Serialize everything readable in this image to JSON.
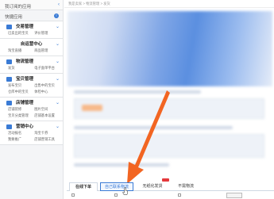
{
  "sidebar": {
    "top": "我订阅的应用",
    "quick": "快捷应用",
    "sections": [
      {
        "title": "交易管理",
        "rows": [
          [
            "已卖出的宝贝",
            "评价管理"
          ]
        ]
      },
      {
        "title": "自运营中心",
        "centered": true,
        "rows": [
          [
            "淘宝直播",
            "商品管理"
          ]
        ]
      },
      {
        "title": "物流管理",
        "rows": [
          [
            "发货",
            "电子面单平台"
          ]
        ]
      },
      {
        "title": "宝贝管理",
        "rows": [
          [
            "发布宝贝",
            "出售中的宝贝"
          ],
          [
            "仓库中的宝贝",
            "体检中心"
          ]
        ]
      },
      {
        "title": "店铺管理",
        "rows": [
          [
            "店铺装修",
            "图片空间"
          ],
          [
            "宝贝分类管理",
            "店铺基本设置"
          ]
        ]
      },
      {
        "title": "营销中心",
        "rows": [
          [
            "活动报名",
            "淘宝卡券"
          ],
          [
            "我要推广",
            "店铺营销工具"
          ]
        ]
      }
    ]
  },
  "main": {
    "breadcrumb": "我是卖家 > 物流管理 > 发货"
  },
  "tabs": [
    {
      "label": "在线下单"
    },
    {
      "label": "自己联系物流"
    },
    {
      "label": "无纸化发货"
    },
    {
      "label": "不需物流"
    }
  ],
  "colors": {
    "accent": "#3a7bd5",
    "arrow": "#f26522"
  }
}
